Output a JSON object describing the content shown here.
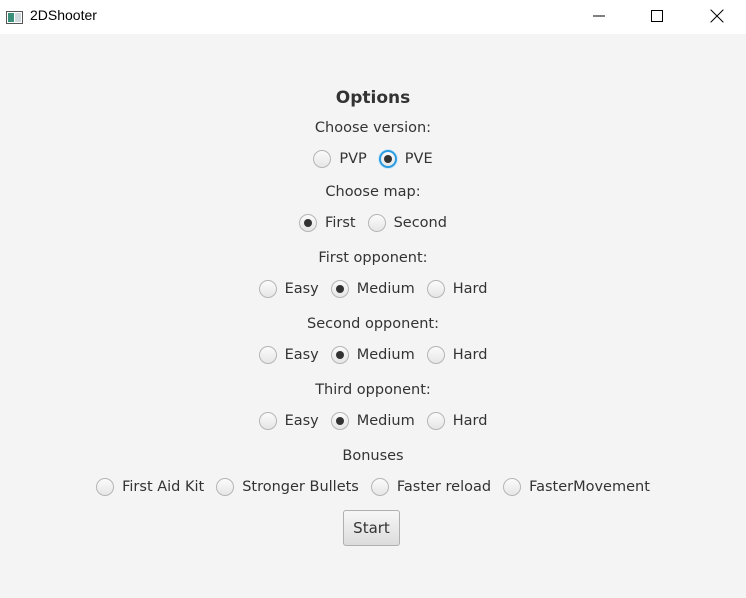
{
  "window": {
    "title": "2DShooter"
  },
  "options": {
    "heading": "Options",
    "version": {
      "label": "Choose version:",
      "items": [
        "PVP",
        "PVE"
      ],
      "selected": "PVE"
    },
    "map": {
      "label": "Choose map:",
      "items": [
        "First",
        "Second"
      ],
      "selected": "First"
    },
    "first_opponent": {
      "label": "First opponent:",
      "items": [
        "Easy",
        "Medium",
        "Hard"
      ],
      "selected": "Medium"
    },
    "second_opponent": {
      "label": "Second opponent:",
      "items": [
        "Easy",
        "Medium",
        "Hard"
      ],
      "selected": "Medium"
    },
    "third_opponent": {
      "label": "Third opponent:",
      "items": [
        "Easy",
        "Medium",
        "Hard"
      ],
      "selected": "Medium"
    },
    "bonuses": {
      "label": "Bonuses",
      "items": [
        "First Aid Kit",
        "Stronger Bullets",
        "Faster reload",
        "FasterMovement"
      ],
      "selected": null
    },
    "start_label": "Start"
  },
  "colors": {
    "background": "#f4f4f4",
    "focus_ring": "#2a9be1",
    "text": "#333333"
  },
  "icons": {
    "app": "app-window-icon",
    "minimize": "minimize-icon",
    "maximize": "maximize-icon",
    "close": "close-icon"
  }
}
